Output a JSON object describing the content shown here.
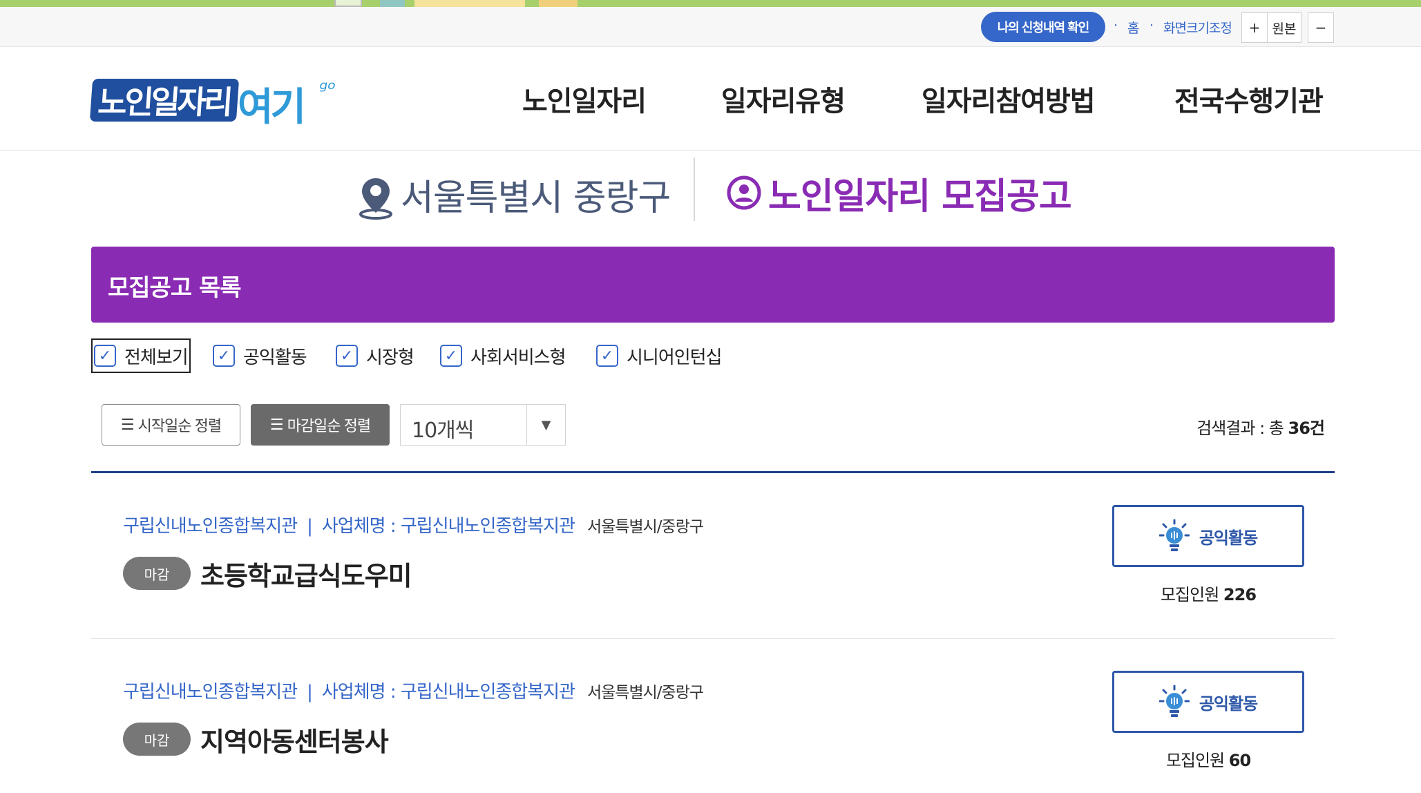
{
  "utility": {
    "apply_check": "나의 신청내역 확인",
    "home": "홈",
    "font_size": "화면크기조정",
    "zoom_in": "+",
    "zoom_reset": "원본",
    "zoom_out": "−"
  },
  "logo": {
    "main": "노인일자리",
    "accent": "여기",
    "sub": "ᵍᵒ"
  },
  "nav": [
    "노인일자리",
    "일자리유형",
    "일자리참여방법",
    "전국수행기관"
  ],
  "location": {
    "region": "서울특별시 중랑구",
    "title": "노인일자리 모집공고"
  },
  "banner": {
    "title": "모집공고 목록"
  },
  "filters": [
    {
      "label": "전체보기",
      "checked": true
    },
    {
      "label": "공익활동",
      "checked": true
    },
    {
      "label": "시장형",
      "checked": true
    },
    {
      "label": "사회서비스형",
      "checked": true
    },
    {
      "label": "시니어인턴십",
      "checked": true
    }
  ],
  "sort": {
    "start_label": "시작일순 정렬",
    "end_label": "마감일순 정렬",
    "per_page": "10개씩",
    "result_prefix": "검색결과 : 총 ",
    "result_count": "36건"
  },
  "jobs": [
    {
      "org": "구립신내노인종합복지관",
      "biz": "사업체명 : 구립신내노인종합복지관",
      "region": "서울특별시/중랑구",
      "status": "마감",
      "title": "초등학교급식도우미",
      "type": "공익활동",
      "recruit_label": "모집인원 ",
      "recruit_count": "226"
    },
    {
      "org": "구립신내노인종합복지관",
      "biz": "사업체명 : 구립신내노인종합복지관",
      "region": "서울특별시/중랑구",
      "status": "마감",
      "title": "지역아동센터봉사",
      "type": "공익활동",
      "recruit_label": "모집인원 ",
      "recruit_count": "60"
    }
  ],
  "colors": {
    "primary_purple": "#8a2bb4",
    "primary_blue": "#3566c9",
    "navy": "#1f3f8a",
    "status_gray": "#777777"
  }
}
